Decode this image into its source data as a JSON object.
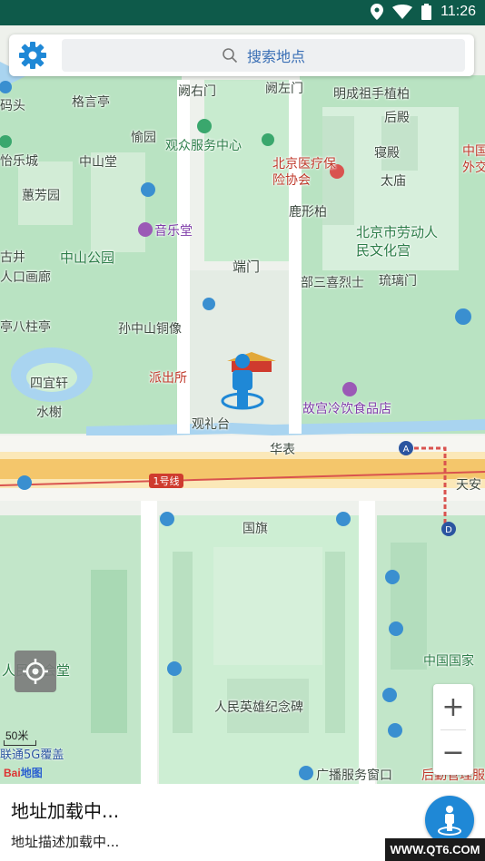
{
  "status_bar": {
    "time": "11:26",
    "icons": [
      "location-icon",
      "wifi-icon",
      "battery-icon"
    ]
  },
  "search": {
    "placeholder": "搜索地点",
    "settings_icon": "gear-icon",
    "search_icon": "search-icon"
  },
  "map": {
    "labels": [
      "码头",
      "格言亭",
      "阙右门",
      "阙左门",
      "明成祖手植柏",
      "后殿",
      "怡乐城",
      "愉园",
      "观众服务中心",
      "中山堂",
      "北京医疗保险协会",
      "寝殿",
      "太庙",
      "中国外交",
      "蕙芳园",
      "鹿形柏",
      "音乐堂",
      "北京市劳动人民文化宫",
      "古井",
      "人口画廊",
      "中山公园",
      "端门",
      "部三喜烈士",
      "琉璃门",
      "亭八柱亭",
      "孙中山铜像",
      "四宜轩",
      "派出所",
      "水榭",
      "故宫冷饮食品店",
      "观礼台",
      "华表",
      "1号线",
      "天安",
      "国旗",
      "中国国家",
      "人民大会堂",
      "人民英雄纪念碑",
      "广播服务窗口",
      "后勤管理服"
    ],
    "scale": "50米",
    "carrier_notice": "联通5G覆盖",
    "logo": {
      "bai": "Bai",
      "du": "地图"
    },
    "zoom_in": "+",
    "zoom_out": "−",
    "metro_stations": [
      "A",
      "D"
    ],
    "colors": {
      "park": "#b9e3c2",
      "road": "#fce5a2",
      "main_road": "#f4c66b",
      "water": "#a9d4f0",
      "metro": "#d9534f",
      "accent": "#1f88d6"
    }
  },
  "bottom": {
    "title": "地址加载中...",
    "description": "地址描述加载中...",
    "watermark": "WWW.QT6.COM"
  }
}
